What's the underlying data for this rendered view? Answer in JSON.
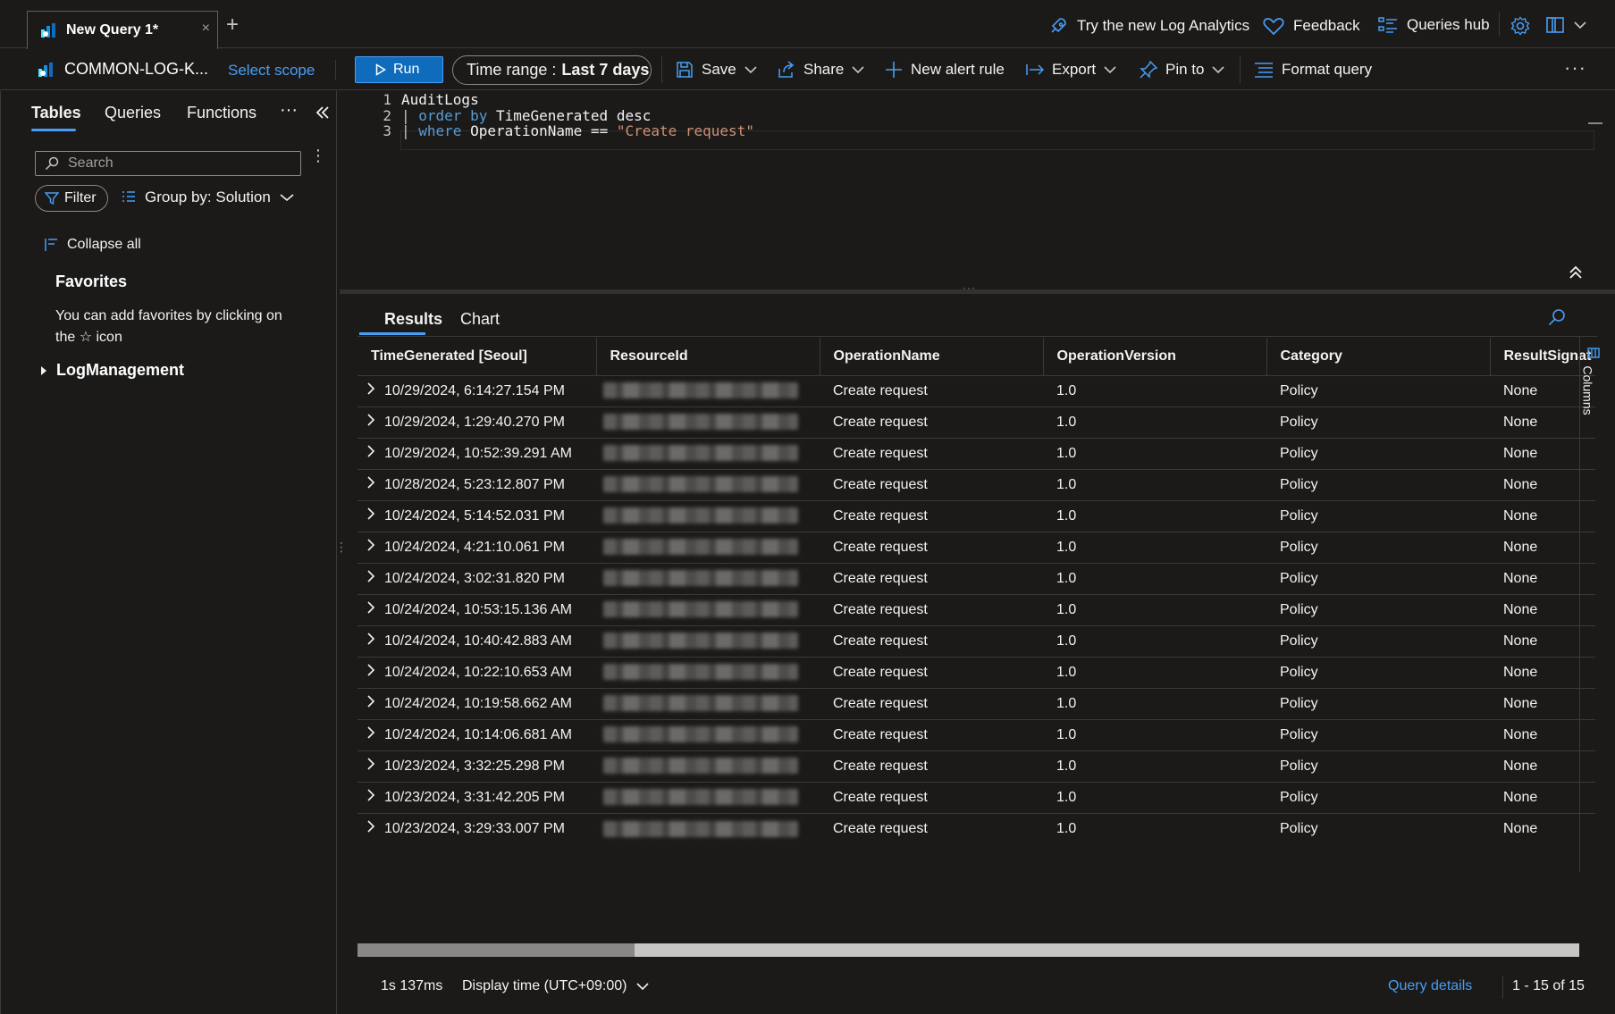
{
  "tabbar": {
    "doc_tab_label": "New Query 1*",
    "try_new": "Try the new Log Analytics",
    "feedback": "Feedback",
    "queries_hub": "Queries hub"
  },
  "cmdbar": {
    "scope_name": "COMMON-LOG-K...",
    "select_scope": "Select scope",
    "run": "Run",
    "time_range_label": "Time range :",
    "time_range_value": "Last 7 days",
    "save": "Save",
    "share": "Share",
    "new_alert": "New alert rule",
    "export": "Export",
    "pin_to": "Pin to",
    "format_query": "Format query",
    "more": "···"
  },
  "left": {
    "tabs": [
      "Tables",
      "Queries",
      "Functions"
    ],
    "more": "···",
    "search_placeholder": "Search",
    "filter": "Filter",
    "group_by": "Group by: Solution",
    "collapse_all": "Collapse all",
    "favorites_title": "Favorites",
    "favorites_hint_1": "You can add favorites by clicking on",
    "favorites_hint_2": "the",
    "favorites_hint_3": "icon",
    "log_management": "LogManagement"
  },
  "editor": {
    "lines": [
      {
        "n": "1",
        "parts": [
          {
            "t": "AuditLogs",
            "c": ""
          }
        ]
      },
      {
        "n": "2",
        "parts": [
          {
            "t": "| ",
            "c": "pipe"
          },
          {
            "t": "order by",
            "c": "kw"
          },
          {
            "t": " TimeGenerated desc",
            "c": ""
          }
        ]
      },
      {
        "n": "3",
        "parts": [
          {
            "t": "| ",
            "c": "pipe"
          },
          {
            "t": "where",
            "c": "kw"
          },
          {
            "t": " OperationName == ",
            "c": ""
          },
          {
            "t": "\"Create request\"",
            "c": "str"
          }
        ]
      }
    ]
  },
  "results": {
    "tabs": [
      "Results",
      "Chart"
    ],
    "columns": [
      "TimeGenerated [Seoul]",
      "ResourceId",
      "OperationName",
      "OperationVersion",
      "Category",
      "ResultSignat"
    ],
    "columns_panel": "Columns",
    "rows": [
      {
        "time": "10/29/2024, 6:14:27.154 PM",
        "op": "Create request",
        "ver": "1.0",
        "cat": "Policy",
        "res": "None"
      },
      {
        "time": "10/29/2024, 1:29:40.270 PM",
        "op": "Create request",
        "ver": "1.0",
        "cat": "Policy",
        "res": "None"
      },
      {
        "time": "10/29/2024, 10:52:39.291 AM",
        "op": "Create request",
        "ver": "1.0",
        "cat": "Policy",
        "res": "None"
      },
      {
        "time": "10/28/2024, 5:23:12.807 PM",
        "op": "Create request",
        "ver": "1.0",
        "cat": "Policy",
        "res": "None"
      },
      {
        "time": "10/24/2024, 5:14:52.031 PM",
        "op": "Create request",
        "ver": "1.0",
        "cat": "Policy",
        "res": "None"
      },
      {
        "time": "10/24/2024, 4:21:10.061 PM",
        "op": "Create request",
        "ver": "1.0",
        "cat": "Policy",
        "res": "None"
      },
      {
        "time": "10/24/2024, 3:02:31.820 PM",
        "op": "Create request",
        "ver": "1.0",
        "cat": "Policy",
        "res": "None"
      },
      {
        "time": "10/24/2024, 10:53:15.136 AM",
        "op": "Create request",
        "ver": "1.0",
        "cat": "Policy",
        "res": "None"
      },
      {
        "time": "10/24/2024, 10:40:42.883 AM",
        "op": "Create request",
        "ver": "1.0",
        "cat": "Policy",
        "res": "None"
      },
      {
        "time": "10/24/2024, 10:22:10.653 AM",
        "op": "Create request",
        "ver": "1.0",
        "cat": "Policy",
        "res": "None"
      },
      {
        "time": "10/24/2024, 10:19:58.662 AM",
        "op": "Create request",
        "ver": "1.0",
        "cat": "Policy",
        "res": "None"
      },
      {
        "time": "10/24/2024, 10:14:06.681 AM",
        "op": "Create request",
        "ver": "1.0",
        "cat": "Policy",
        "res": "None"
      },
      {
        "time": "10/23/2024, 3:32:25.298 PM",
        "op": "Create request",
        "ver": "1.0",
        "cat": "Policy",
        "res": "None"
      },
      {
        "time": "10/23/2024, 3:31:42.205 PM",
        "op": "Create request",
        "ver": "1.0",
        "cat": "Policy",
        "res": "None"
      },
      {
        "time": "10/23/2024, 3:29:33.007 PM",
        "op": "Create request",
        "ver": "1.0",
        "cat": "Policy",
        "res": "None"
      }
    ],
    "status": {
      "duration": "1s 137ms",
      "display_time": "Display time (UTC+09:00)",
      "query_details": "Query details",
      "range": "1 - 15 of 15"
    }
  },
  "colors": {
    "accent": "#479ef5",
    "run_bg": "#0f6cbd",
    "background": "#1b1a19",
    "keyword": "#569cd6",
    "string": "#ce9178"
  },
  "icons": [
    "log-analytics-icon",
    "rocket-icon",
    "heart-icon",
    "queries-hub-icon",
    "gear-icon",
    "book-icon",
    "play-icon",
    "save-icon",
    "share-icon",
    "plus-icon",
    "export-icon",
    "pin-icon",
    "format-icon",
    "search-icon",
    "filter-icon",
    "group-icon",
    "collapse-icon",
    "star-icon",
    "chevron-right-icon",
    "chevron-down-icon",
    "double-chevron-left-icon",
    "double-chevron-up-icon",
    "columns-icon"
  ]
}
